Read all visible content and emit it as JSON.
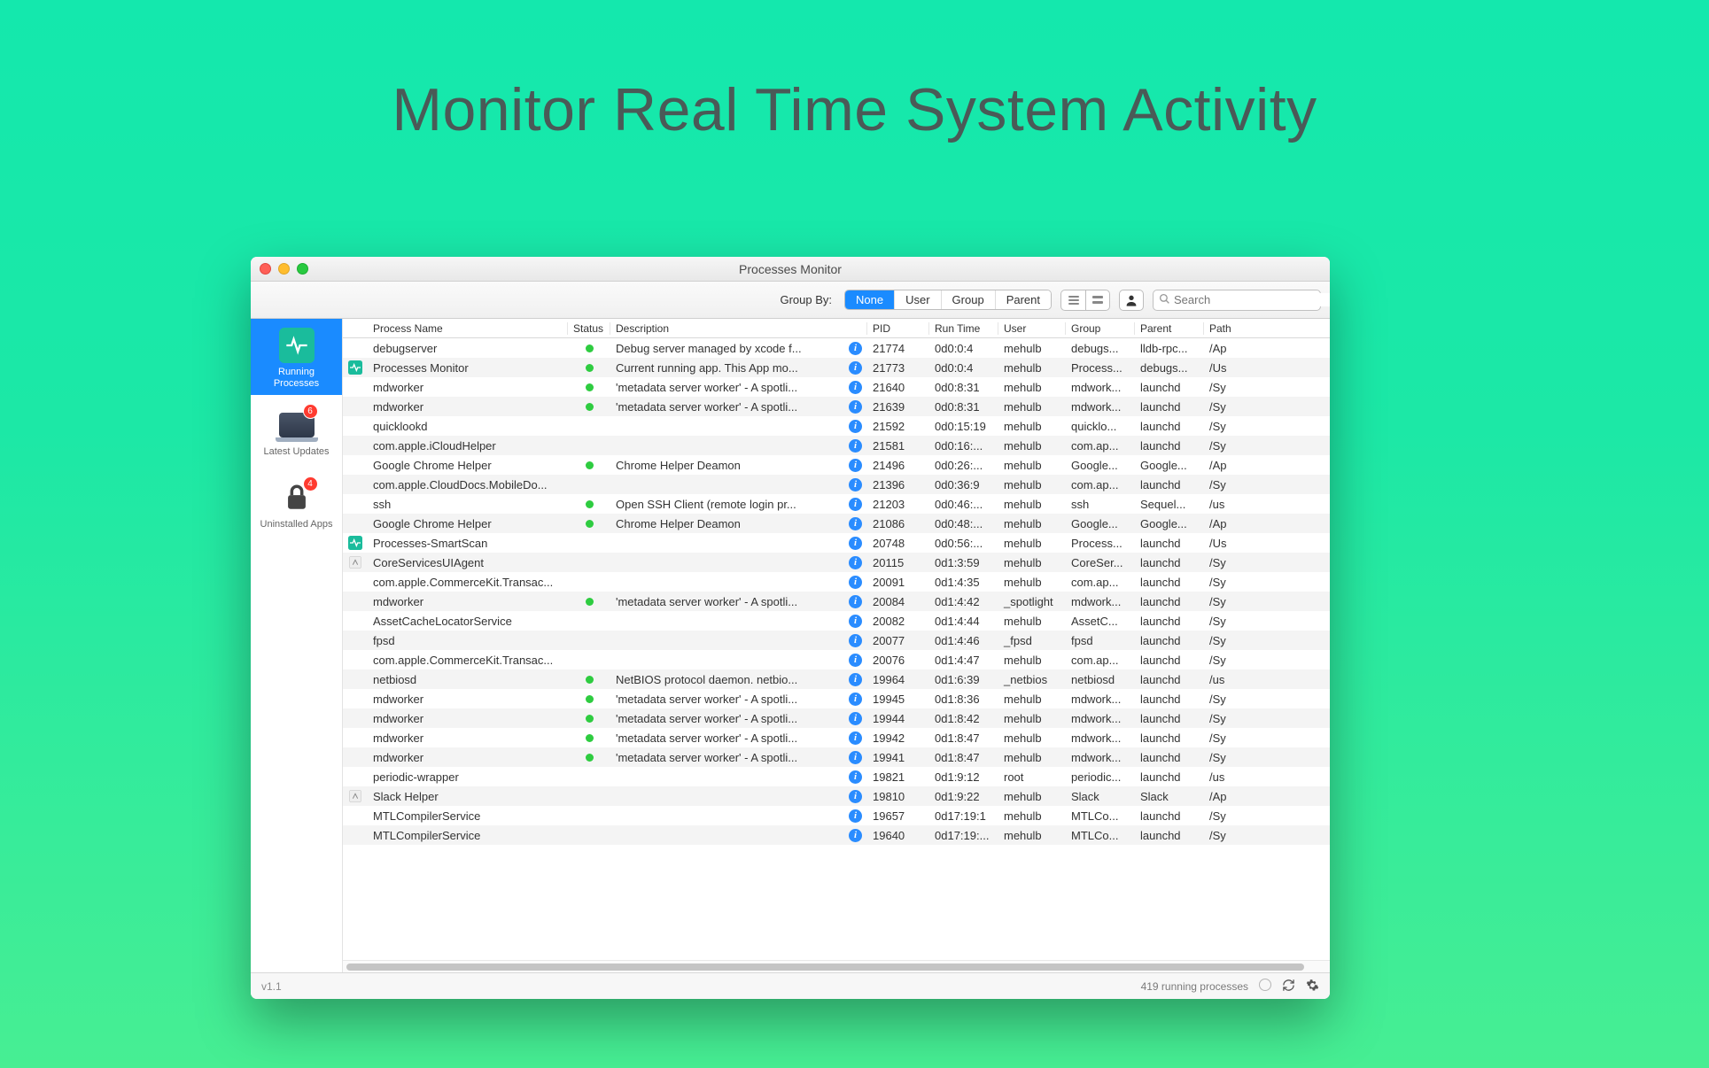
{
  "hero": {
    "title": "Monitor Real Time System Activity"
  },
  "window": {
    "title": "Processes Monitor"
  },
  "toolbar": {
    "groupby_label": "Group By:",
    "segments": [
      "None",
      "User",
      "Group",
      "Parent"
    ],
    "active_segment": 0,
    "search_placeholder": "Search"
  },
  "sidebar": {
    "items": [
      {
        "label": "Running Processes",
        "icon": "heartbeat",
        "active": true
      },
      {
        "label": "Latest Updates",
        "icon": "laptop",
        "badge": "6"
      },
      {
        "label": "Uninstalled Apps",
        "icon": "lock",
        "badge": "4"
      }
    ]
  },
  "columns": [
    "",
    "Process Name",
    "Status",
    "Description",
    "PID",
    "Run Time",
    "User",
    "Group",
    "Parent",
    "Path"
  ],
  "rows": [
    {
      "icon": "",
      "name": "debugserver",
      "status": true,
      "desc": "Debug server managed by xcode f...",
      "info": true,
      "pid": "21774",
      "runtime": "0d0:0:4",
      "user": "mehulb",
      "group": "debugs...",
      "parent": "lldb-rpc...",
      "path": "/Ap"
    },
    {
      "icon": "hb",
      "name": "Processes Monitor",
      "status": true,
      "desc": "Current running app. This App mo...",
      "info": true,
      "pid": "21773",
      "runtime": "0d0:0:4",
      "user": "mehulb",
      "group": "Process...",
      "parent": "debugs...",
      "path": "/Us"
    },
    {
      "icon": "",
      "name": "mdworker",
      "status": true,
      "desc": "'metadata server worker' - A spotli...",
      "info": true,
      "pid": "21640",
      "runtime": "0d0:8:31",
      "user": "mehulb",
      "group": "mdwork...",
      "parent": "launchd",
      "path": "/Sy"
    },
    {
      "icon": "",
      "name": "mdworker",
      "status": true,
      "desc": "'metadata server worker' - A spotli...",
      "info": true,
      "pid": "21639",
      "runtime": "0d0:8:31",
      "user": "mehulb",
      "group": "mdwork...",
      "parent": "launchd",
      "path": "/Sy"
    },
    {
      "icon": "",
      "name": "quicklookd",
      "status": false,
      "desc": "",
      "info": true,
      "pid": "21592",
      "runtime": "0d0:15:19",
      "user": "mehulb",
      "group": "quicklo...",
      "parent": "launchd",
      "path": "/Sy"
    },
    {
      "icon": "",
      "name": "com.apple.iCloudHelper",
      "status": false,
      "desc": "",
      "info": true,
      "pid": "21581",
      "runtime": "0d0:16:...",
      "user": "mehulb",
      "group": "com.ap...",
      "parent": "launchd",
      "path": "/Sy"
    },
    {
      "icon": "",
      "name": "Google Chrome Helper",
      "status": true,
      "desc": "Chrome Helper Deamon",
      "info": true,
      "pid": "21496",
      "runtime": "0d0:26:...",
      "user": "mehulb",
      "group": "Google...",
      "parent": "Google...",
      "path": "/Ap"
    },
    {
      "icon": "",
      "name": "com.apple.CloudDocs.MobileDo...",
      "status": false,
      "desc": "",
      "info": true,
      "pid": "21396",
      "runtime": "0d0:36:9",
      "user": "mehulb",
      "group": "com.ap...",
      "parent": "launchd",
      "path": "/Sy"
    },
    {
      "icon": "",
      "name": "ssh",
      "status": true,
      "desc": "Open SSH Client (remote login pr...",
      "info": true,
      "pid": "21203",
      "runtime": "0d0:46:...",
      "user": "mehulb",
      "group": "ssh",
      "parent": "Sequel...",
      "path": "/us"
    },
    {
      "icon": "",
      "name": "Google Chrome Helper",
      "status": true,
      "desc": "Chrome Helper Deamon",
      "info": true,
      "pid": "21086",
      "runtime": "0d0:48:...",
      "user": "mehulb",
      "group": "Google...",
      "parent": "Google...",
      "path": "/Ap"
    },
    {
      "icon": "hb",
      "name": "Processes-SmartScan",
      "status": false,
      "desc": "",
      "info": true,
      "pid": "20748",
      "runtime": "0d0:56:...",
      "user": "mehulb",
      "group": "Process...",
      "parent": "launchd",
      "path": "/Us"
    },
    {
      "icon": "app",
      "name": "CoreServicesUIAgent",
      "status": false,
      "desc": "",
      "info": true,
      "pid": "20115",
      "runtime": "0d1:3:59",
      "user": "mehulb",
      "group": "CoreSer...",
      "parent": "launchd",
      "path": "/Sy"
    },
    {
      "icon": "",
      "name": "com.apple.CommerceKit.Transac...",
      "status": false,
      "desc": "",
      "info": true,
      "pid": "20091",
      "runtime": "0d1:4:35",
      "user": "mehulb",
      "group": "com.ap...",
      "parent": "launchd",
      "path": "/Sy"
    },
    {
      "icon": "",
      "name": "mdworker",
      "status": true,
      "desc": "'metadata server worker' - A spotli...",
      "info": true,
      "pid": "20084",
      "runtime": "0d1:4:42",
      "user": "_spotlight",
      "group": "mdwork...",
      "parent": "launchd",
      "path": "/Sy"
    },
    {
      "icon": "",
      "name": "AssetCacheLocatorService",
      "status": false,
      "desc": "",
      "info": true,
      "pid": "20082",
      "runtime": "0d1:4:44",
      "user": "mehulb",
      "group": "AssetC...",
      "parent": "launchd",
      "path": "/Sy"
    },
    {
      "icon": "",
      "name": "fpsd",
      "status": false,
      "desc": "",
      "info": true,
      "pid": "20077",
      "runtime": "0d1:4:46",
      "user": "_fpsd",
      "group": "fpsd",
      "parent": "launchd",
      "path": "/Sy"
    },
    {
      "icon": "",
      "name": "com.apple.CommerceKit.Transac...",
      "status": false,
      "desc": "",
      "info": true,
      "pid": "20076",
      "runtime": "0d1:4:47",
      "user": "mehulb",
      "group": "com.ap...",
      "parent": "launchd",
      "path": "/Sy"
    },
    {
      "icon": "",
      "name": "netbiosd",
      "status": true,
      "desc": "NetBIOS protocol daemon. netbio...",
      "info": true,
      "pid": "19964",
      "runtime": "0d1:6:39",
      "user": "_netbios",
      "group": "netbiosd",
      "parent": "launchd",
      "path": "/us"
    },
    {
      "icon": "",
      "name": "mdworker",
      "status": true,
      "desc": "'metadata server worker' - A spotli...",
      "info": true,
      "pid": "19945",
      "runtime": "0d1:8:36",
      "user": "mehulb",
      "group": "mdwork...",
      "parent": "launchd",
      "path": "/Sy"
    },
    {
      "icon": "",
      "name": "mdworker",
      "status": true,
      "desc": "'metadata server worker' - A spotli...",
      "info": true,
      "pid": "19944",
      "runtime": "0d1:8:42",
      "user": "mehulb",
      "group": "mdwork...",
      "parent": "launchd",
      "path": "/Sy"
    },
    {
      "icon": "",
      "name": "mdworker",
      "status": true,
      "desc": "'metadata server worker' - A spotli...",
      "info": true,
      "pid": "19942",
      "runtime": "0d1:8:47",
      "user": "mehulb",
      "group": "mdwork...",
      "parent": "launchd",
      "path": "/Sy"
    },
    {
      "icon": "",
      "name": "mdworker",
      "status": true,
      "desc": "'metadata server worker' - A spotli...",
      "info": true,
      "pid": "19941",
      "runtime": "0d1:8:47",
      "user": "mehulb",
      "group": "mdwork...",
      "parent": "launchd",
      "path": "/Sy"
    },
    {
      "icon": "",
      "name": "periodic-wrapper",
      "status": false,
      "desc": "",
      "info": true,
      "pid": "19821",
      "runtime": "0d1:9:12",
      "user": "root",
      "group": "periodic...",
      "parent": "launchd",
      "path": "/us"
    },
    {
      "icon": "app",
      "name": "Slack Helper",
      "status": false,
      "desc": "",
      "info": true,
      "pid": "19810",
      "runtime": "0d1:9:22",
      "user": "mehulb",
      "group": "Slack",
      "parent": "Slack",
      "path": "/Ap"
    },
    {
      "icon": "",
      "name": "MTLCompilerService",
      "status": false,
      "desc": "",
      "info": true,
      "pid": "19657",
      "runtime": "0d17:19:1",
      "user": "mehulb",
      "group": "MTLCo...",
      "parent": "launchd",
      "path": "/Sy"
    },
    {
      "icon": "",
      "name": "MTLCompilerService",
      "status": false,
      "desc": "",
      "info": true,
      "pid": "19640",
      "runtime": "0d17:19:...",
      "user": "mehulb",
      "group": "MTLCo...",
      "parent": "launchd",
      "path": "/Sy"
    }
  ],
  "statusbar": {
    "version": "v1.1",
    "count": "419 running processes"
  }
}
